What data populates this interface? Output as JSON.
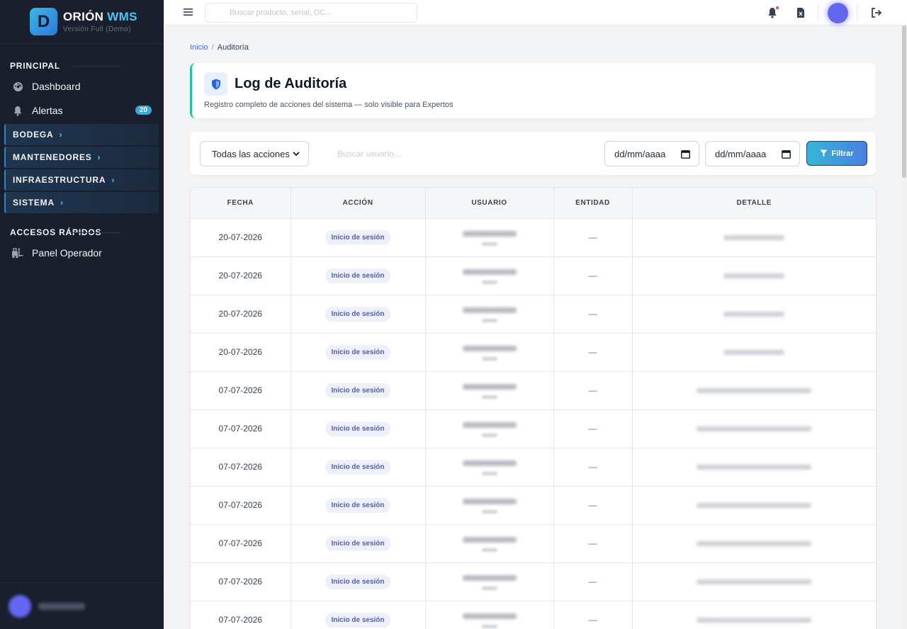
{
  "brand": {
    "logo_letter": "D",
    "name_main": "ORIÓN",
    "name_accent": "WMS",
    "subtitle": "Versión Full (Demo)"
  },
  "sidebar": {
    "section_principal": "PRINCIPAL",
    "dashboard": "Dashboard",
    "alertas": "Alertas",
    "alertas_count": "20",
    "groups": [
      "BODEGA",
      "MANTENEDORES",
      "INFRAESTRUCTURA",
      "SISTEMA"
    ],
    "section_accesos": "ACCESOS RÁPIDOS",
    "panel_operador": "Panel Operador"
  },
  "topbar": {
    "search_placeholder": "Buscar producto, serial, OC..."
  },
  "breadcrumb": {
    "home": "Inicio",
    "current": "Auditoría"
  },
  "header": {
    "title": "Log de Auditoría",
    "subtitle": "Registro completo de acciones del sistema — solo visible para Expertos"
  },
  "filters": {
    "action_select": "Todas las acciones",
    "user_search_placeholder": "Buscar usuario...",
    "date_from": "dd/mm/aaaa",
    "date_to": "dd/mm/aaaa",
    "filter_button": "Filtrar"
  },
  "table": {
    "columns": [
      "FECHA",
      "ACCIÓN",
      "USUARIO",
      "ENTIDAD",
      "DETALLE"
    ],
    "rows": [
      {
        "fecha": "20-07-2026",
        "accion": "Inicio de sesión",
        "entidad": "—"
      },
      {
        "fecha": "20-07-2026",
        "accion": "Inicio de sesión",
        "entidad": "—"
      },
      {
        "fecha": "20-07-2026",
        "accion": "Inicio de sesión",
        "entidad": "—"
      },
      {
        "fecha": "20-07-2026",
        "accion": "Inicio de sesión",
        "entidad": "—"
      },
      {
        "fecha": "07-07-2026",
        "accion": "Inicio de sesión",
        "entidad": "—"
      },
      {
        "fecha": "07-07-2026",
        "accion": "Inicio de sesión",
        "entidad": "—"
      },
      {
        "fecha": "07-07-2026",
        "accion": "Inicio de sesión",
        "entidad": "—"
      },
      {
        "fecha": "07-07-2026",
        "accion": "Inicio de sesión",
        "entidad": "—"
      },
      {
        "fecha": "07-07-2026",
        "accion": "Inicio de sesión",
        "entidad": "—"
      },
      {
        "fecha": "07-07-2026",
        "accion": "Inicio de sesión",
        "entidad": "—"
      },
      {
        "fecha": "07-07-2026",
        "accion": "Inicio de sesión",
        "entidad": "—"
      }
    ]
  },
  "colors": {
    "sidebar_bg": "#1a1f2e",
    "accent": "#4fc3f7",
    "header_border": "#22c3a6",
    "pill_text": "#4f5fbf"
  }
}
